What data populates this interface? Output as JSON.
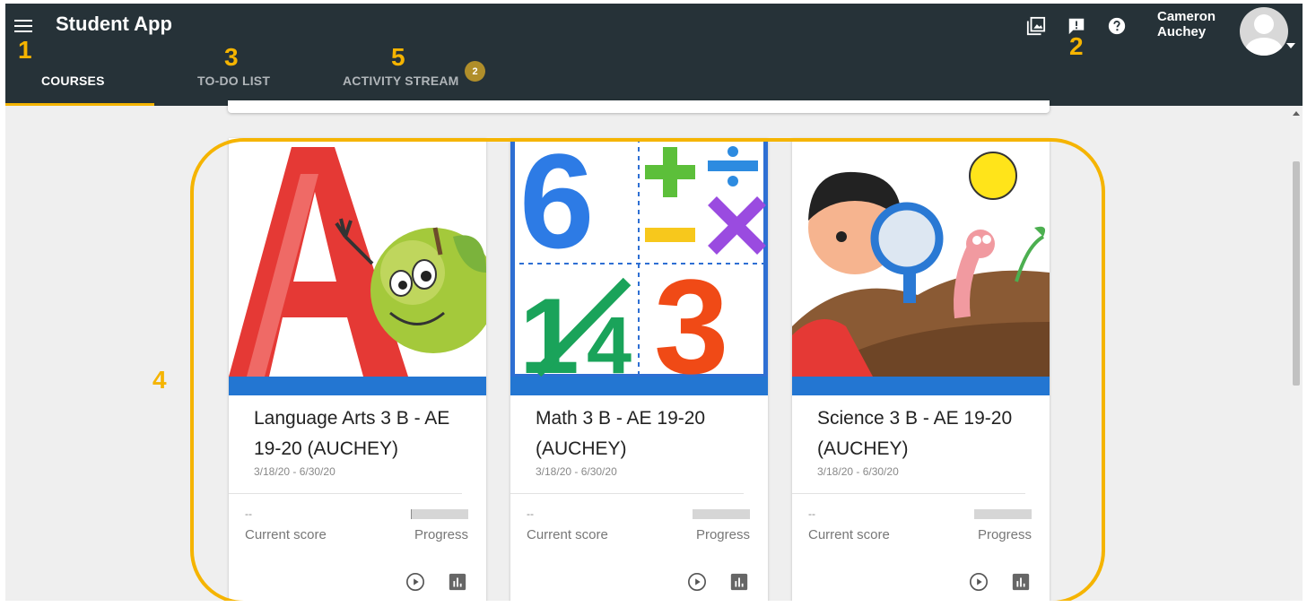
{
  "app": {
    "title": "Student App"
  },
  "tabs": [
    {
      "label": "COURSES",
      "active": true
    },
    {
      "label": "TO-DO LIST",
      "active": false
    },
    {
      "label": "ACTIVITY STREAM",
      "active": false,
      "badge": "2"
    }
  ],
  "user": {
    "first_name": "Cameron",
    "last_name": "Auchey"
  },
  "header_icons": [
    "gallery-icon",
    "feedback-icon",
    "help-icon"
  ],
  "callouts": {
    "menu": "1",
    "feedback": "2",
    "todo": "3",
    "courses": "4",
    "activity": "5"
  },
  "courses": [
    {
      "title": "Language Arts 3 B - AE 19-20 (AUCHEY)",
      "dates": "3/18/20 - 6/30/20",
      "score": "--",
      "score_label": "Current score",
      "progress_label": "Progress",
      "progress": 0.02
    },
    {
      "title": "Math 3 B - AE 19-20 (AUCHEY)",
      "dates": "3/18/20 - 6/30/20",
      "score": "--",
      "score_label": "Current score",
      "progress_label": "Progress",
      "progress": 0
    },
    {
      "title": "Science 3 B - AE 19-20 (AUCHEY)",
      "dates": "3/18/20 - 6/30/20",
      "score": "--",
      "score_label": "Current score",
      "progress_label": "Progress",
      "progress": 0
    }
  ],
  "colors": {
    "header": "#263238",
    "accent": "#f4b400",
    "card_bar": "#2376d2",
    "callout": "#f5b400"
  }
}
